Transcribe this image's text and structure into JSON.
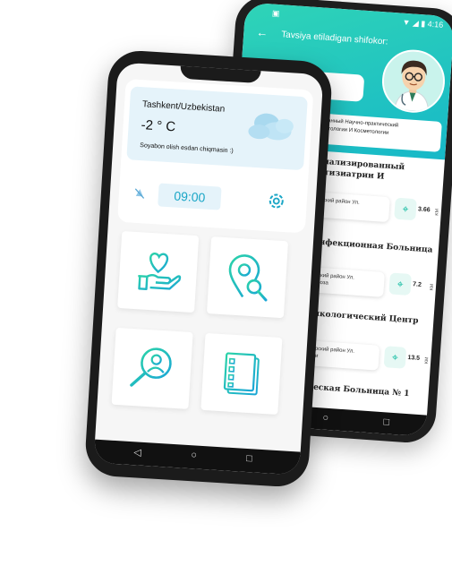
{
  "back_screen": {
    "status_left": "▣",
    "status_right": "▼ ◢ ▮ 4:16",
    "back_arrow": "←",
    "title": "Tavsiya etiladigan shifokor:",
    "clinic_label": "ованный Научно-практический\nматологии И Косметологии",
    "hospitals": [
      {
        "name_line1": "циализированный",
        "name_line2": "Фтизиатрии И",
        "address": "лский район Ул.",
        "distance": "3.66",
        "unit": "KM"
      },
      {
        "name_line1": "Инфекционная Больница №",
        "name_line2": "",
        "address": "лский район Ул.\nрвоза",
        "distance": "7.2",
        "unit": "KM"
      },
      {
        "name_line1": "Онкологический Центр",
        "name_line2": "",
        "address": "хурский район Ул.\nоби",
        "distance": "13.5",
        "unit": "KM"
      },
      {
        "name_line1": "ическая Больница № 1",
        "name_line2": "",
        "address": "",
        "distance": "",
        "unit": ""
      }
    ],
    "nav": {
      "circle": "○",
      "square": "□"
    }
  },
  "front_screen": {
    "weather": {
      "city": "Tashkent/Uzbekistan",
      "temperature": "-2 ° C",
      "advice": "Soyabon olish esdan chiqmasin :)"
    },
    "alarm_time": "09:00",
    "tiles": [
      {
        "icon": "heart-hand-icon"
      },
      {
        "icon": "location-search-icon"
      },
      {
        "icon": "doctor-search-icon"
      },
      {
        "icon": "checklist-icon"
      }
    ],
    "nav": {
      "back": "◁",
      "home": "○",
      "recents": "□"
    }
  },
  "colors": {
    "accent": "#1dbfa6",
    "accent_blue": "#1aa6c6",
    "weather_bg": "#e5f3fa"
  }
}
